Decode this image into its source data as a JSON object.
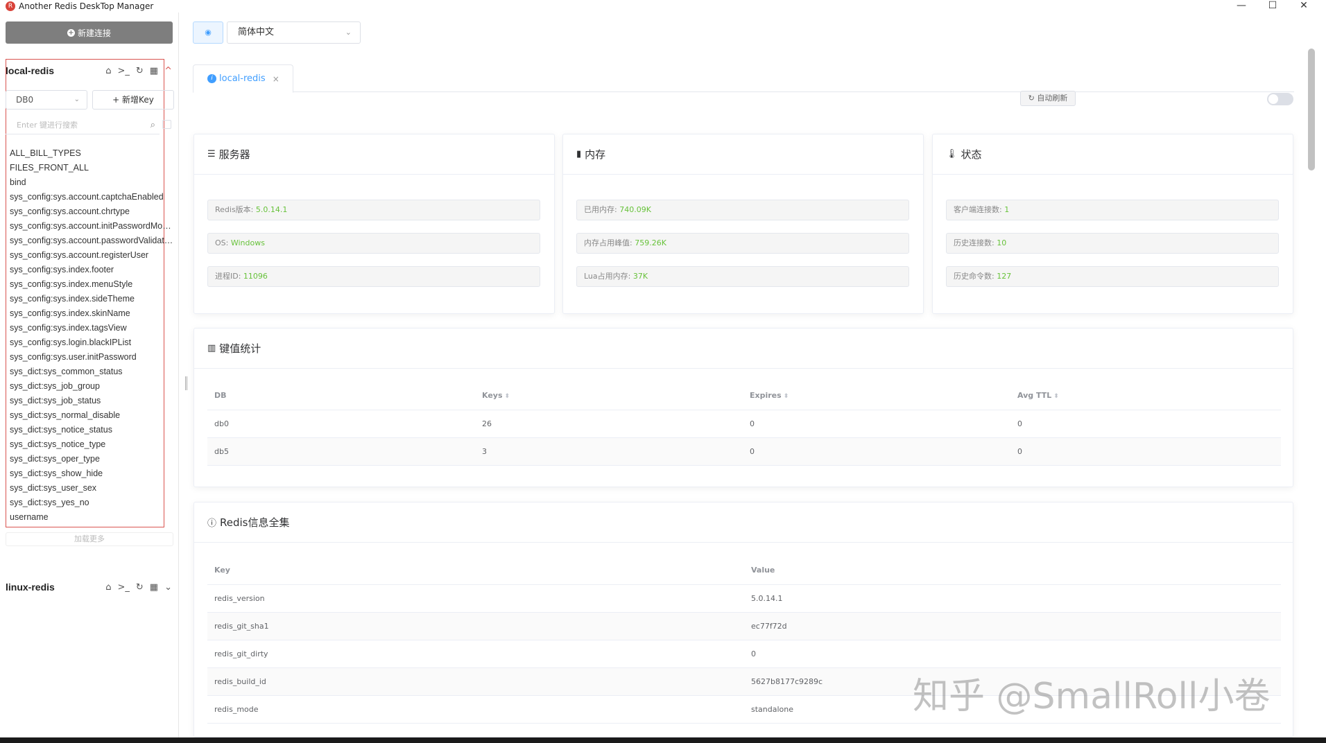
{
  "window": {
    "title": "Another Redis DeskTop Manager",
    "minimize": "—",
    "maximize": "☐",
    "close": "✕"
  },
  "sidebar": {
    "new_connection": "新建连接",
    "connections": [
      {
        "name": "local-redis"
      },
      {
        "name": "linux-redis"
      }
    ],
    "db_select": "DB0",
    "new_key": "+ 新增Key",
    "search_placeholder": "Enter 键进行搜索",
    "keys": [
      "ALL_BILL_TYPES",
      "FILES_FRONT_ALL",
      "bind",
      "sys_config:sys.account.captchaEnabled",
      "sys_config:sys.account.chrtype",
      "sys_config:sys.account.initPasswordModify",
      "sys_config:sys.account.passwordValidateDays",
      "sys_config:sys.account.registerUser",
      "sys_config:sys.index.footer",
      "sys_config:sys.index.menuStyle",
      "sys_config:sys.index.sideTheme",
      "sys_config:sys.index.skinName",
      "sys_config:sys.index.tagsView",
      "sys_config:sys.login.blackIPList",
      "sys_config:sys.user.initPassword",
      "sys_dict:sys_common_status",
      "sys_dict:sys_job_group",
      "sys_dict:sys_job_status",
      "sys_dict:sys_normal_disable",
      "sys_dict:sys_notice_status",
      "sys_dict:sys_notice_type",
      "sys_dict:sys_oper_type",
      "sys_dict:sys_show_hide",
      "sys_dict:sys_user_sex",
      "sys_dict:sys_yes_no",
      "username"
    ],
    "load_more": "加载更多"
  },
  "main": {
    "language": "简体中文",
    "tab": {
      "label": "local-redis",
      "close": "×"
    },
    "auto_refresh": "自动刷新",
    "server": {
      "title": "服务器",
      "rows": [
        {
          "label": "Redis版本: ",
          "value": "5.0.14.1"
        },
        {
          "label": "OS: ",
          "value": "Windows"
        },
        {
          "label": "进程ID: ",
          "value": "11096"
        }
      ]
    },
    "memory": {
      "title": "内存",
      "rows": [
        {
          "label": "已用内存: ",
          "value": "740.09K"
        },
        {
          "label": "内存占用峰值: ",
          "value": "759.26K"
        },
        {
          "label": "Lua占用内存: ",
          "value": "37K"
        }
      ]
    },
    "status": {
      "title": "状态",
      "rows": [
        {
          "label": "客户端连接数: ",
          "value": "1"
        },
        {
          "label": "历史连接数: ",
          "value": "10"
        },
        {
          "label": "历史命令数: ",
          "value": "127"
        }
      ]
    },
    "key_stats": {
      "title": "键值统计",
      "headers": [
        "DB",
        "Keys",
        "Expires",
        "Avg TTL"
      ],
      "rows": [
        [
          "db0",
          "26",
          "0",
          "0"
        ],
        [
          "db5",
          "3",
          "0",
          "0"
        ]
      ]
    },
    "info": {
      "title": "Redis信息全集",
      "headers": [
        "Key",
        "Value"
      ],
      "rows": [
        [
          "redis_version",
          "5.0.14.1"
        ],
        [
          "redis_git_sha1",
          "ec77f72d"
        ],
        [
          "redis_git_dirty",
          "0"
        ],
        [
          "redis_build_id",
          "5627b8177c9289c"
        ],
        [
          "redis_mode",
          "standalone"
        ]
      ]
    }
  },
  "watermark": "知乎 @SmallRoll小卷"
}
